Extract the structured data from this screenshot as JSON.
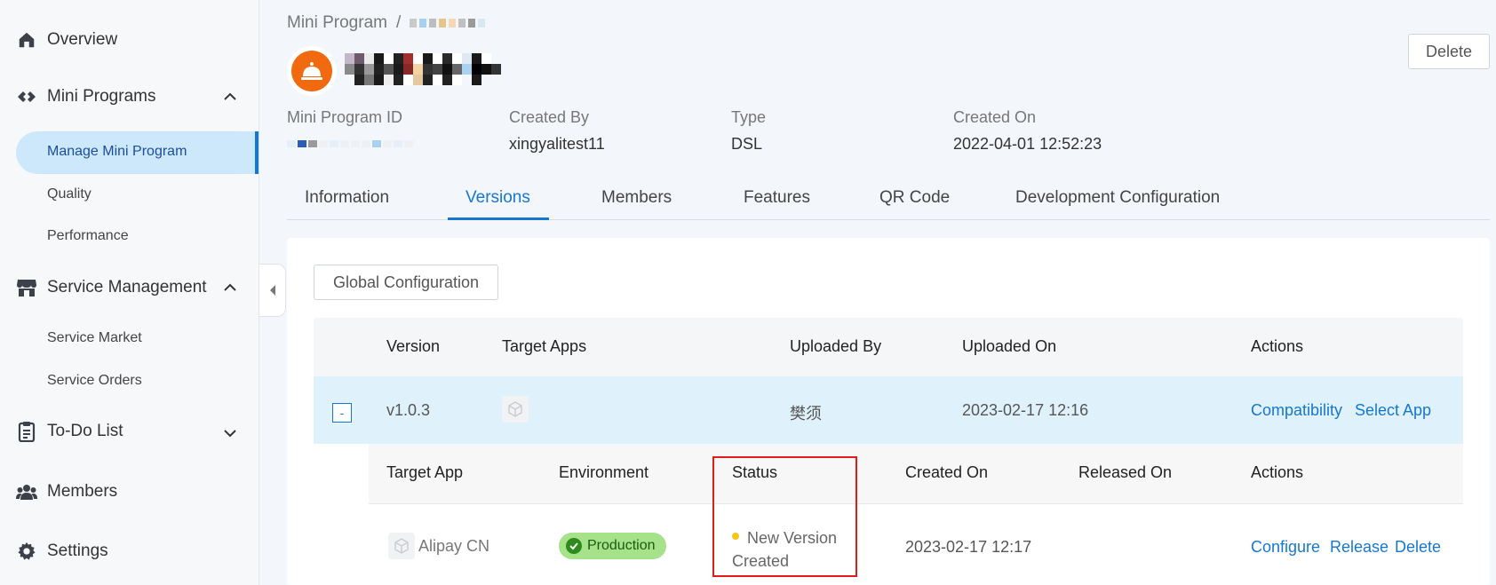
{
  "sidebar": {
    "overview": "Overview",
    "mini_programs": "Mini Programs",
    "manage_mini_program": "Manage Mini Program",
    "quality": "Quality",
    "performance": "Performance",
    "service_management": "Service Management",
    "service_market": "Service Market",
    "service_orders": "Service Orders",
    "todo_list": "To-Do List",
    "members": "Members",
    "settings": "Settings"
  },
  "header": {
    "breadcrumb_root": "Mini Program",
    "breadcrumb_sep": "/",
    "delete_label": "Delete"
  },
  "meta": {
    "id_label": "Mini Program ID",
    "created_by_label": "Created By",
    "created_by_value": "xingyalitest11",
    "type_label": "Type",
    "type_value": "DSL",
    "created_on_label": "Created On",
    "created_on_value": "2022-04-01 12:52:23"
  },
  "tabs": [
    "Information",
    "Versions",
    "Members",
    "Features",
    "QR Code",
    "Development Configuration"
  ],
  "versions": {
    "global_config_label": "Global Configuration",
    "columns": {
      "version": "Version",
      "target_apps": "Target Apps",
      "uploaded_by": "Uploaded By",
      "uploaded_on": "Uploaded On",
      "actions": "Actions"
    },
    "row": {
      "expand": "-",
      "version": "v1.0.3",
      "uploaded_by": "樊须",
      "uploaded_on": "2023-02-17 12:16",
      "action_compat": "Compatibility",
      "action_select": "Select App"
    },
    "sub_columns": {
      "target_app": "Target App",
      "environment": "Environment",
      "status": "Status",
      "created_on": "Created On",
      "released_on": "Released On",
      "actions": "Actions"
    },
    "sub_row": {
      "target_app": "Alipay CN",
      "environment": "Production",
      "status_line1": "New Version",
      "status_line2": "Created",
      "created_on": "2023-02-17 12:17",
      "action_configure": "Configure",
      "action_release": "Release",
      "action_delete": "Delete"
    }
  },
  "colors": {
    "accent": "#1677d2",
    "highlight": "#e31b1b",
    "badge_bg": "#a6e28a",
    "status_dot": "#f5c518"
  }
}
